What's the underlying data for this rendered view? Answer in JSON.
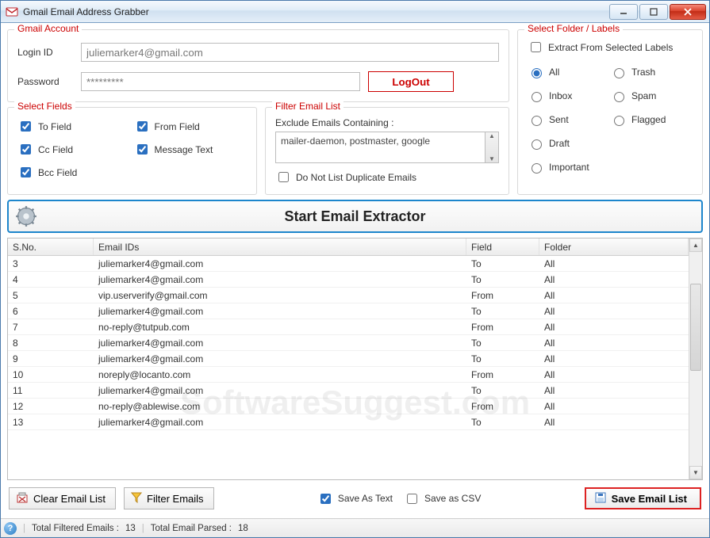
{
  "window": {
    "title": "Gmail Email Address Grabber"
  },
  "account": {
    "legend": "Gmail Account",
    "login_label": "Login ID",
    "login_value": "juliemarker4@gmail.com",
    "password_label": "Password",
    "password_value": "*********",
    "logout_label": "LogOut"
  },
  "select_fields": {
    "legend": "Select Fields",
    "to": "To Field",
    "cc": "Cc Field",
    "bcc": "Bcc Field",
    "from": "From Field",
    "msg": "Message Text"
  },
  "filter": {
    "legend": "Filter Email List",
    "exclude_label": "Exclude Emails Containing :",
    "exclude_value": "mailer-daemon, postmaster, google",
    "nodup_label": "Do Not List Duplicate Emails"
  },
  "folders": {
    "legend": "Select Folder / Labels",
    "extract_chk": "Extract From Selected Labels",
    "options": [
      "All",
      "Trash",
      "Inbox",
      "Spam",
      "Sent",
      "Flagged",
      "Draft",
      "",
      "Important",
      ""
    ],
    "selected": "All"
  },
  "start_label": "Start Email Extractor",
  "table": {
    "columns": [
      "S.No.",
      "Email IDs",
      "Field",
      "Folder"
    ],
    "rows": [
      {
        "sno": "3",
        "email": "juliemarker4@gmail.com",
        "field": "To",
        "folder": "All"
      },
      {
        "sno": "4",
        "email": "juliemarker4@gmail.com",
        "field": "To",
        "folder": "All"
      },
      {
        "sno": "5",
        "email": "vip.userverify@gmail.com",
        "field": "From",
        "folder": "All"
      },
      {
        "sno": "6",
        "email": "juliemarker4@gmail.com",
        "field": "To",
        "folder": "All"
      },
      {
        "sno": "7",
        "email": "no-reply@tutpub.com",
        "field": "From",
        "folder": "All"
      },
      {
        "sno": "8",
        "email": "juliemarker4@gmail.com",
        "field": "To",
        "folder": "All"
      },
      {
        "sno": "9",
        "email": "juliemarker4@gmail.com",
        "field": "To",
        "folder": "All"
      },
      {
        "sno": "10",
        "email": "noreply@locanto.com",
        "field": "From",
        "folder": "All"
      },
      {
        "sno": "11",
        "email": "juliemarker4@gmail.com",
        "field": "To",
        "folder": "All"
      },
      {
        "sno": "12",
        "email": "no-reply@ablewise.com",
        "field": "From",
        "folder": "All"
      },
      {
        "sno": "13",
        "email": "juliemarker4@gmail.com",
        "field": "To",
        "folder": "All"
      }
    ]
  },
  "bottom": {
    "clear": "Clear Email List",
    "filter": "Filter Emails",
    "save_text": "Save As Text",
    "save_csv": "Save as CSV",
    "save_list": "Save Email List"
  },
  "status": {
    "filtered_label": "Total Filtered Emails :",
    "filtered_value": "13",
    "parsed_label": "Total Email Parsed :",
    "parsed_value": "18"
  },
  "watermark": "SoftwareSuggest.com"
}
